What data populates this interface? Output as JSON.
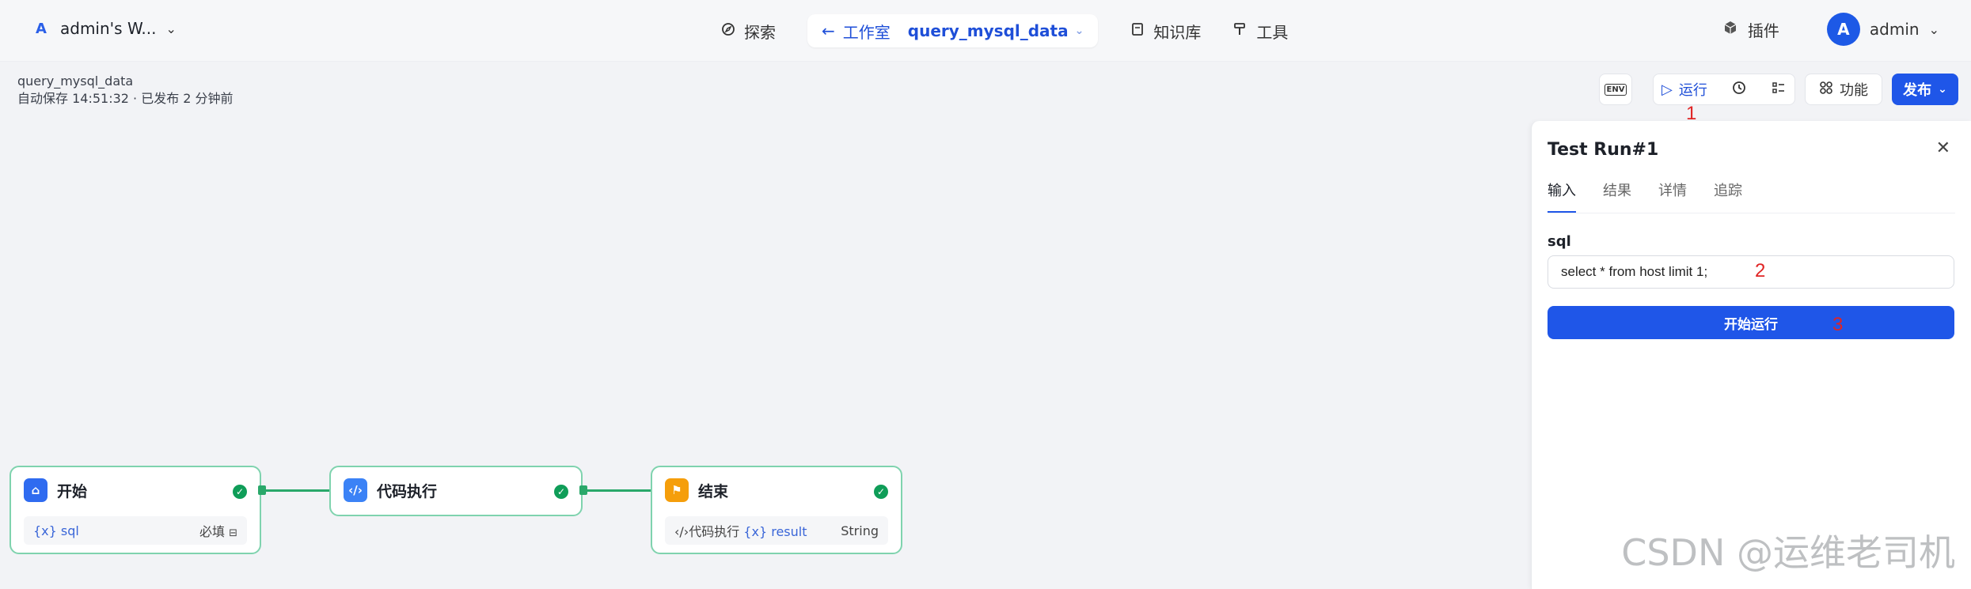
{
  "header": {
    "workspace_avatar": "A",
    "workspace_name": "admin's W...",
    "nav_explore": "探索",
    "nav_studio": "工作室",
    "nav_flow": "query_mysql_data",
    "nav_knowledge": "知识库",
    "nav_tools": "工具",
    "plugin": "插件",
    "user_avatar": "A",
    "user_name": "admin"
  },
  "flow": {
    "name": "query_mysql_data",
    "status": "自动保存 14:51:32 · 已发布 2 分钟前"
  },
  "toolbar": {
    "env": "ENV",
    "run": "运行",
    "feature": "功能",
    "publish": "发布"
  },
  "annotations": [
    "1",
    "2",
    "3"
  ],
  "panel": {
    "title": "Test Run#1",
    "tabs": [
      "输入",
      "结果",
      "详情",
      "追踪"
    ],
    "field_label": "sql",
    "field_value": "select * from host limit 1;",
    "start_button": "开始运行"
  },
  "nodes": [
    {
      "title": "开始",
      "row_left_prefix": "{x}",
      "row_left": "sql",
      "row_right": "必填",
      "color": "#2f6bf0"
    },
    {
      "title": "代码执行",
      "color": "#3b82f6"
    },
    {
      "title": "结束",
      "row_left_prefix": "‹/›代码执行",
      "row_var_prefix": "{x}",
      "row_left": "result",
      "row_right": "String",
      "color": "#f59e0b"
    }
  ],
  "watermark": "CSDN @运维老司机"
}
